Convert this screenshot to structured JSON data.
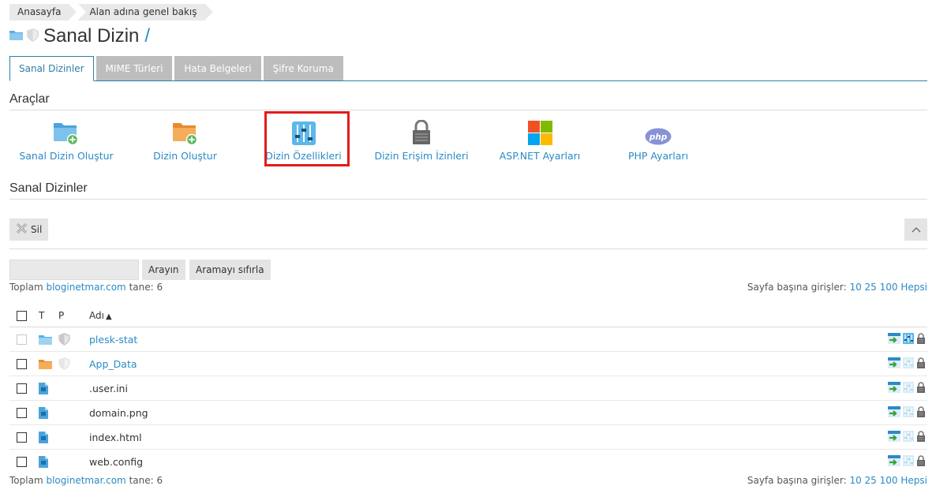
{
  "breadcrumb": [
    "Anasayfa",
    "Alan adına genel bakış"
  ],
  "page": {
    "title": "Sanal Dizin",
    "title_suffix": "/"
  },
  "tabs": [
    "Sanal Dizinler",
    "MIME Türleri",
    "Hata Belgeleri",
    "Şifre Koruma"
  ],
  "tools_section": {
    "title": "Araçlar"
  },
  "tools": [
    {
      "label": "Sanal Dizin Oluştur",
      "icon": "folder-add-icon"
    },
    {
      "label": "Dizin Oluştur",
      "icon": "folder-add-orange-icon"
    },
    {
      "label": "Dizin Özellikleri",
      "icon": "sliders-icon"
    },
    {
      "label": "Dizin Erişim İzinleri",
      "icon": "lock-icon"
    },
    {
      "label": "ASP.NET Ayarları",
      "icon": "windows-icon"
    },
    {
      "label": "PHP Ayarları",
      "icon": "php-icon"
    }
  ],
  "list_section": {
    "title": "Sanal Dizinler"
  },
  "toolbar": {
    "delete_label": "Sil"
  },
  "search": {
    "value": "",
    "placeholder": "",
    "search_label": "Arayın",
    "reset_label": "Aramayı sıfırla"
  },
  "summary": {
    "prefix": "Toplam",
    "domain": "bloginetmar.com",
    "suffix": "tane: 6"
  },
  "pagination": {
    "label": "Sayfa başına girişler:",
    "options": [
      "10",
      "25",
      "100",
      "Hepsi"
    ]
  },
  "table": {
    "headers": {
      "type": "T",
      "protection": "P",
      "name": "Adı"
    },
    "rows": [
      {
        "name": "plesk-stat",
        "kind": "folder-blue",
        "is_link": true
      },
      {
        "name": "App_Data",
        "kind": "folder-orange",
        "is_link": true
      },
      {
        "name": ".user.ini",
        "kind": "file",
        "is_link": false
      },
      {
        "name": "domain.png",
        "kind": "file",
        "is_link": false
      },
      {
        "name": "index.html",
        "kind": "file",
        "is_link": false
      },
      {
        "name": "web.config",
        "kind": "file",
        "is_link": false
      }
    ]
  },
  "colors": {
    "accent": "#2b8ac6",
    "highlight": "#e21b1b",
    "tab_inactive": "#bdbdbd"
  }
}
